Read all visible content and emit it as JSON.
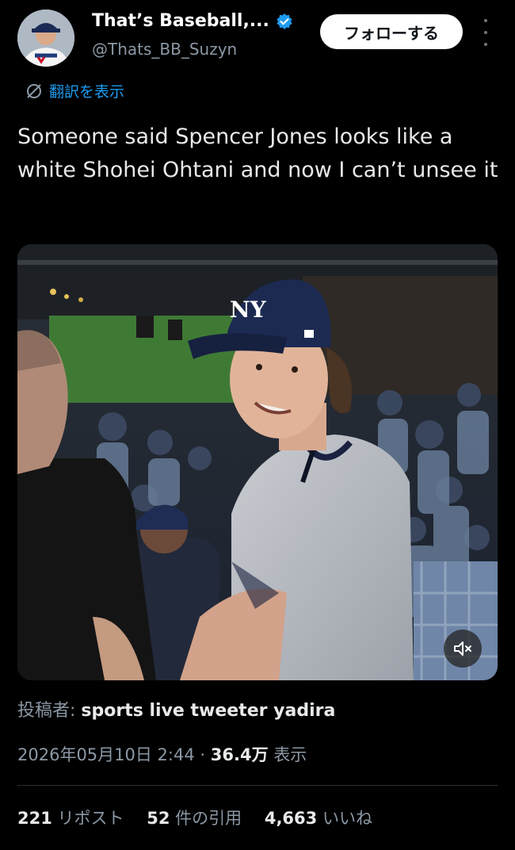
{
  "author": {
    "display_name": "That’s Baseball,...",
    "handle": "@Thats_BB_Suzyn",
    "avatar_icon": "player-avatar",
    "verified": true,
    "verified_color": "#1d9bf0"
  },
  "actions": {
    "follow_label": "フォローする",
    "more_icon": "more-vertical-icon"
  },
  "translate": {
    "label": "翻訳を表示",
    "icon": "globe-icon"
  },
  "tweet": {
    "text": "Someone said Spencer Jones looks like a white Shohei Ohtani and now I can’t unsee it"
  },
  "media": {
    "mute_icon": "volume-muted-icon",
    "cap_logo": "NY"
  },
  "attribution": {
    "label": "投稿者:",
    "value": "sports live tweeter yadira"
  },
  "meta": {
    "timestamp": "2026年05月10日 2:44",
    "separator": "·",
    "views": "36.4万",
    "views_label": "表示"
  },
  "stats": {
    "reposts": "221",
    "reposts_label": "リポスト",
    "quotes": "52",
    "quotes_label": "件の引用",
    "likes": "4,663",
    "likes_label": "いいね"
  },
  "colors": {
    "background": "#000000",
    "accent": "#1d9bf0",
    "secondary_text": "#8b98a5"
  }
}
